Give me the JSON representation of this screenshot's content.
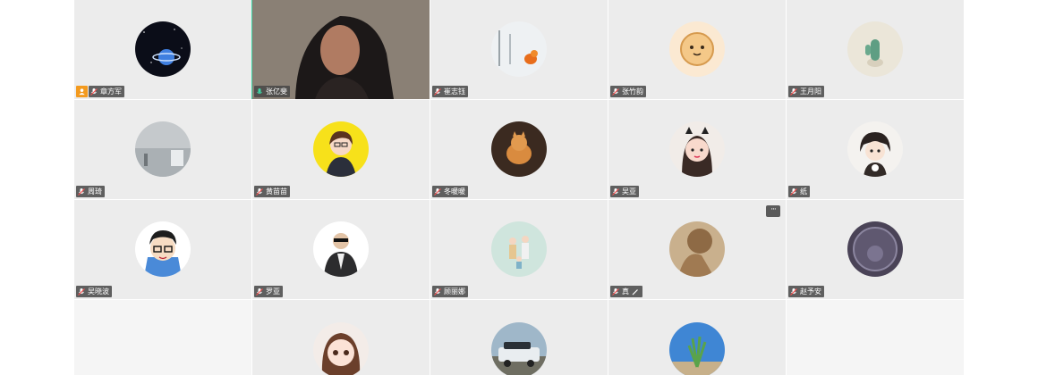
{
  "participants": [
    {
      "name": "章方军",
      "avatar": "planet-avatar",
      "host": true,
      "row": 1
    },
    {
      "name": "张亿斐",
      "avatar": "camera-video",
      "video": true,
      "row": 1
    },
    {
      "name": "崔志钰",
      "avatar": "snow-bird-avatar",
      "row": 1
    },
    {
      "name": "张竹韵",
      "avatar": "cookie-avatar",
      "row": 1
    },
    {
      "name": "王月阳",
      "avatar": "cactus-avatar",
      "row": 1
    },
    {
      "name": "周琦",
      "avatar": "misty-sky-avatar",
      "row": 2
    },
    {
      "name": "黄苗苗",
      "avatar": "cartoon-girl-yellow-avatar",
      "row": 2
    },
    {
      "name": "冬暖暖",
      "avatar": "cat-avatar",
      "row": 2
    },
    {
      "name": "吴亚",
      "avatar": "child-cat-ears-avatar",
      "row": 2
    },
    {
      "name": "纸",
      "avatar": "chibi-boy-avatar",
      "row": 2
    },
    {
      "name": "吴晓波",
      "avatar": "cartoon-boy-glasses-avatar",
      "row": 3
    },
    {
      "name": "罗亚",
      "avatar": "man-suit-avatar",
      "row": 3
    },
    {
      "name": "顾丽娜",
      "avatar": "family-illustration-avatar",
      "row": 3
    },
    {
      "name": "真",
      "avatar": "sculpture-avatar",
      "more": true,
      "pen": true,
      "row": 3
    },
    {
      "name": "赵予安",
      "avatar": "coin-avatar",
      "row": 3
    },
    {
      "empty": true,
      "row": 4
    },
    {
      "avatar": "anime-girl-avatar",
      "row": 4
    },
    {
      "avatar": "car-avatar",
      "row": 4
    },
    {
      "avatar": "plant-sky-avatar",
      "row": 4
    },
    {
      "empty": true,
      "row": 4
    }
  ],
  "more_label": "···",
  "colors": {
    "tile": "#ececec",
    "active_speaker": "#3fd6a6",
    "host_badge": "#f39a1e",
    "name_tag": "#464646"
  }
}
